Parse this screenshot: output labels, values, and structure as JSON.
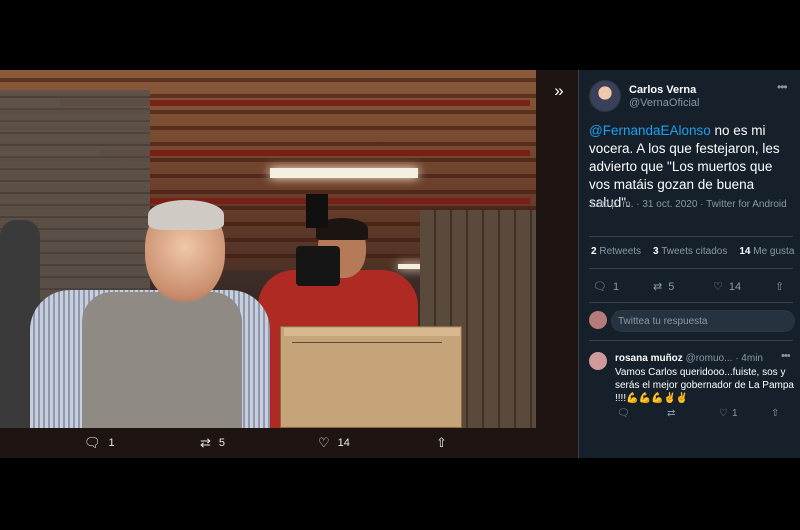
{
  "viewer": {
    "expand_icon": "chevrons-right-icon",
    "actions": {
      "reply": {
        "icon": "reply-icon",
        "count": "1"
      },
      "retweet": {
        "icon": "retweet-icon",
        "count": "5"
      },
      "like": {
        "icon": "heart-icon",
        "count": "14"
      },
      "share": {
        "icon": "share-icon"
      }
    }
  },
  "tweet": {
    "author_name": "Carlos Verna",
    "author_handle": "@VernaOficial",
    "more": "•••",
    "mention": "@FernandaEAlonso",
    "text": " no es mi vocera. A los que festejaron, les advierto que \"Los muertos que vos matáis gozan de buena salud\".",
    "meta": "1:30 p. m. · 31 oct. 2020 · Twitter for Android",
    "stats": {
      "retweets_count": "2",
      "retweets_label": "Retweets",
      "quotes_count": "3",
      "quotes_label": "Tweets citados",
      "likes_count": "14",
      "likes_label": "Me gusta"
    },
    "actions": {
      "reply_count": "1",
      "retweet_count": "5",
      "like_count": "14"
    },
    "reply_placeholder": "Twittea tu respuesta"
  },
  "comment": {
    "name": "rosana muñoz",
    "handle": "@romuo...",
    "time": "· 4min",
    "more": "•••",
    "text": "Vamos Carlos queridooo...fuiste, sos y serás el mejor gobernador de La Pampa !!!!💪💪💪✌✌",
    "like_count": "1"
  },
  "colors": {
    "panel_bg": "#15202b",
    "accent": "#1da1f2",
    "muted": "#8899a6"
  }
}
